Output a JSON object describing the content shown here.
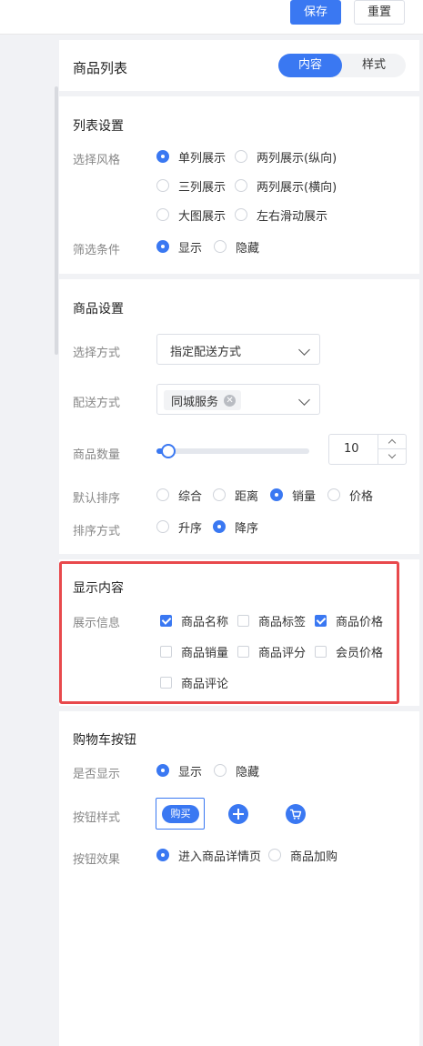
{
  "toolbar": {
    "save_label": "保存",
    "reset_label": "重置"
  },
  "header": {
    "title": "商品列表",
    "tabs": [
      "内容",
      "样式"
    ]
  },
  "list_settings": {
    "title": "列表设置",
    "style_label": "选择风格",
    "style_options": [
      "单列展示",
      "两列展示(纵向)",
      "三列展示",
      "两列展示(横向)",
      "大图展示",
      "左右滑动展示"
    ],
    "style_selected": "单列展示",
    "filter_label": "筛选条件",
    "filter_options": [
      "显示",
      "隐藏"
    ],
    "filter_selected": "显示"
  },
  "product_settings": {
    "title": "商品设置",
    "method_label": "选择方式",
    "method_value": "指定配送方式",
    "delivery_label": "配送方式",
    "delivery_tag": "同城服务",
    "count_label": "商品数量",
    "count_value": "10",
    "count_slider_fraction": 0.08,
    "sort_label": "默认排序",
    "sort_options": [
      "综合",
      "距离",
      "销量",
      "价格"
    ],
    "sort_selected": "销量",
    "order_label": "排序方式",
    "order_options": [
      "升序",
      "降序"
    ],
    "order_selected": "降序"
  },
  "display_content": {
    "title": "显示内容",
    "info_label": "展示信息",
    "options": [
      {
        "label": "商品名称",
        "checked": true
      },
      {
        "label": "商品标签",
        "checked": false
      },
      {
        "label": "商品价格",
        "checked": true
      },
      {
        "label": "商品销量",
        "checked": false
      },
      {
        "label": "商品评分",
        "checked": false
      },
      {
        "label": "会员价格",
        "checked": false
      },
      {
        "label": "商品评论",
        "checked": false
      }
    ]
  },
  "cart_button": {
    "title": "购物车按钮",
    "show_label": "是否显示",
    "show_options": [
      "显示",
      "隐藏"
    ],
    "show_selected": "显示",
    "style_label": "按钮样式",
    "buy_label": "购买",
    "style_icons": [
      "plus-icon",
      "cart-icon"
    ],
    "effect_label": "按钮效果",
    "effect_options": [
      "进入商品详情页",
      "商品加购"
    ],
    "effect_selected": "进入商品详情页"
  },
  "colors": {
    "accent": "#3a78f2",
    "highlight": "#e8494c"
  }
}
